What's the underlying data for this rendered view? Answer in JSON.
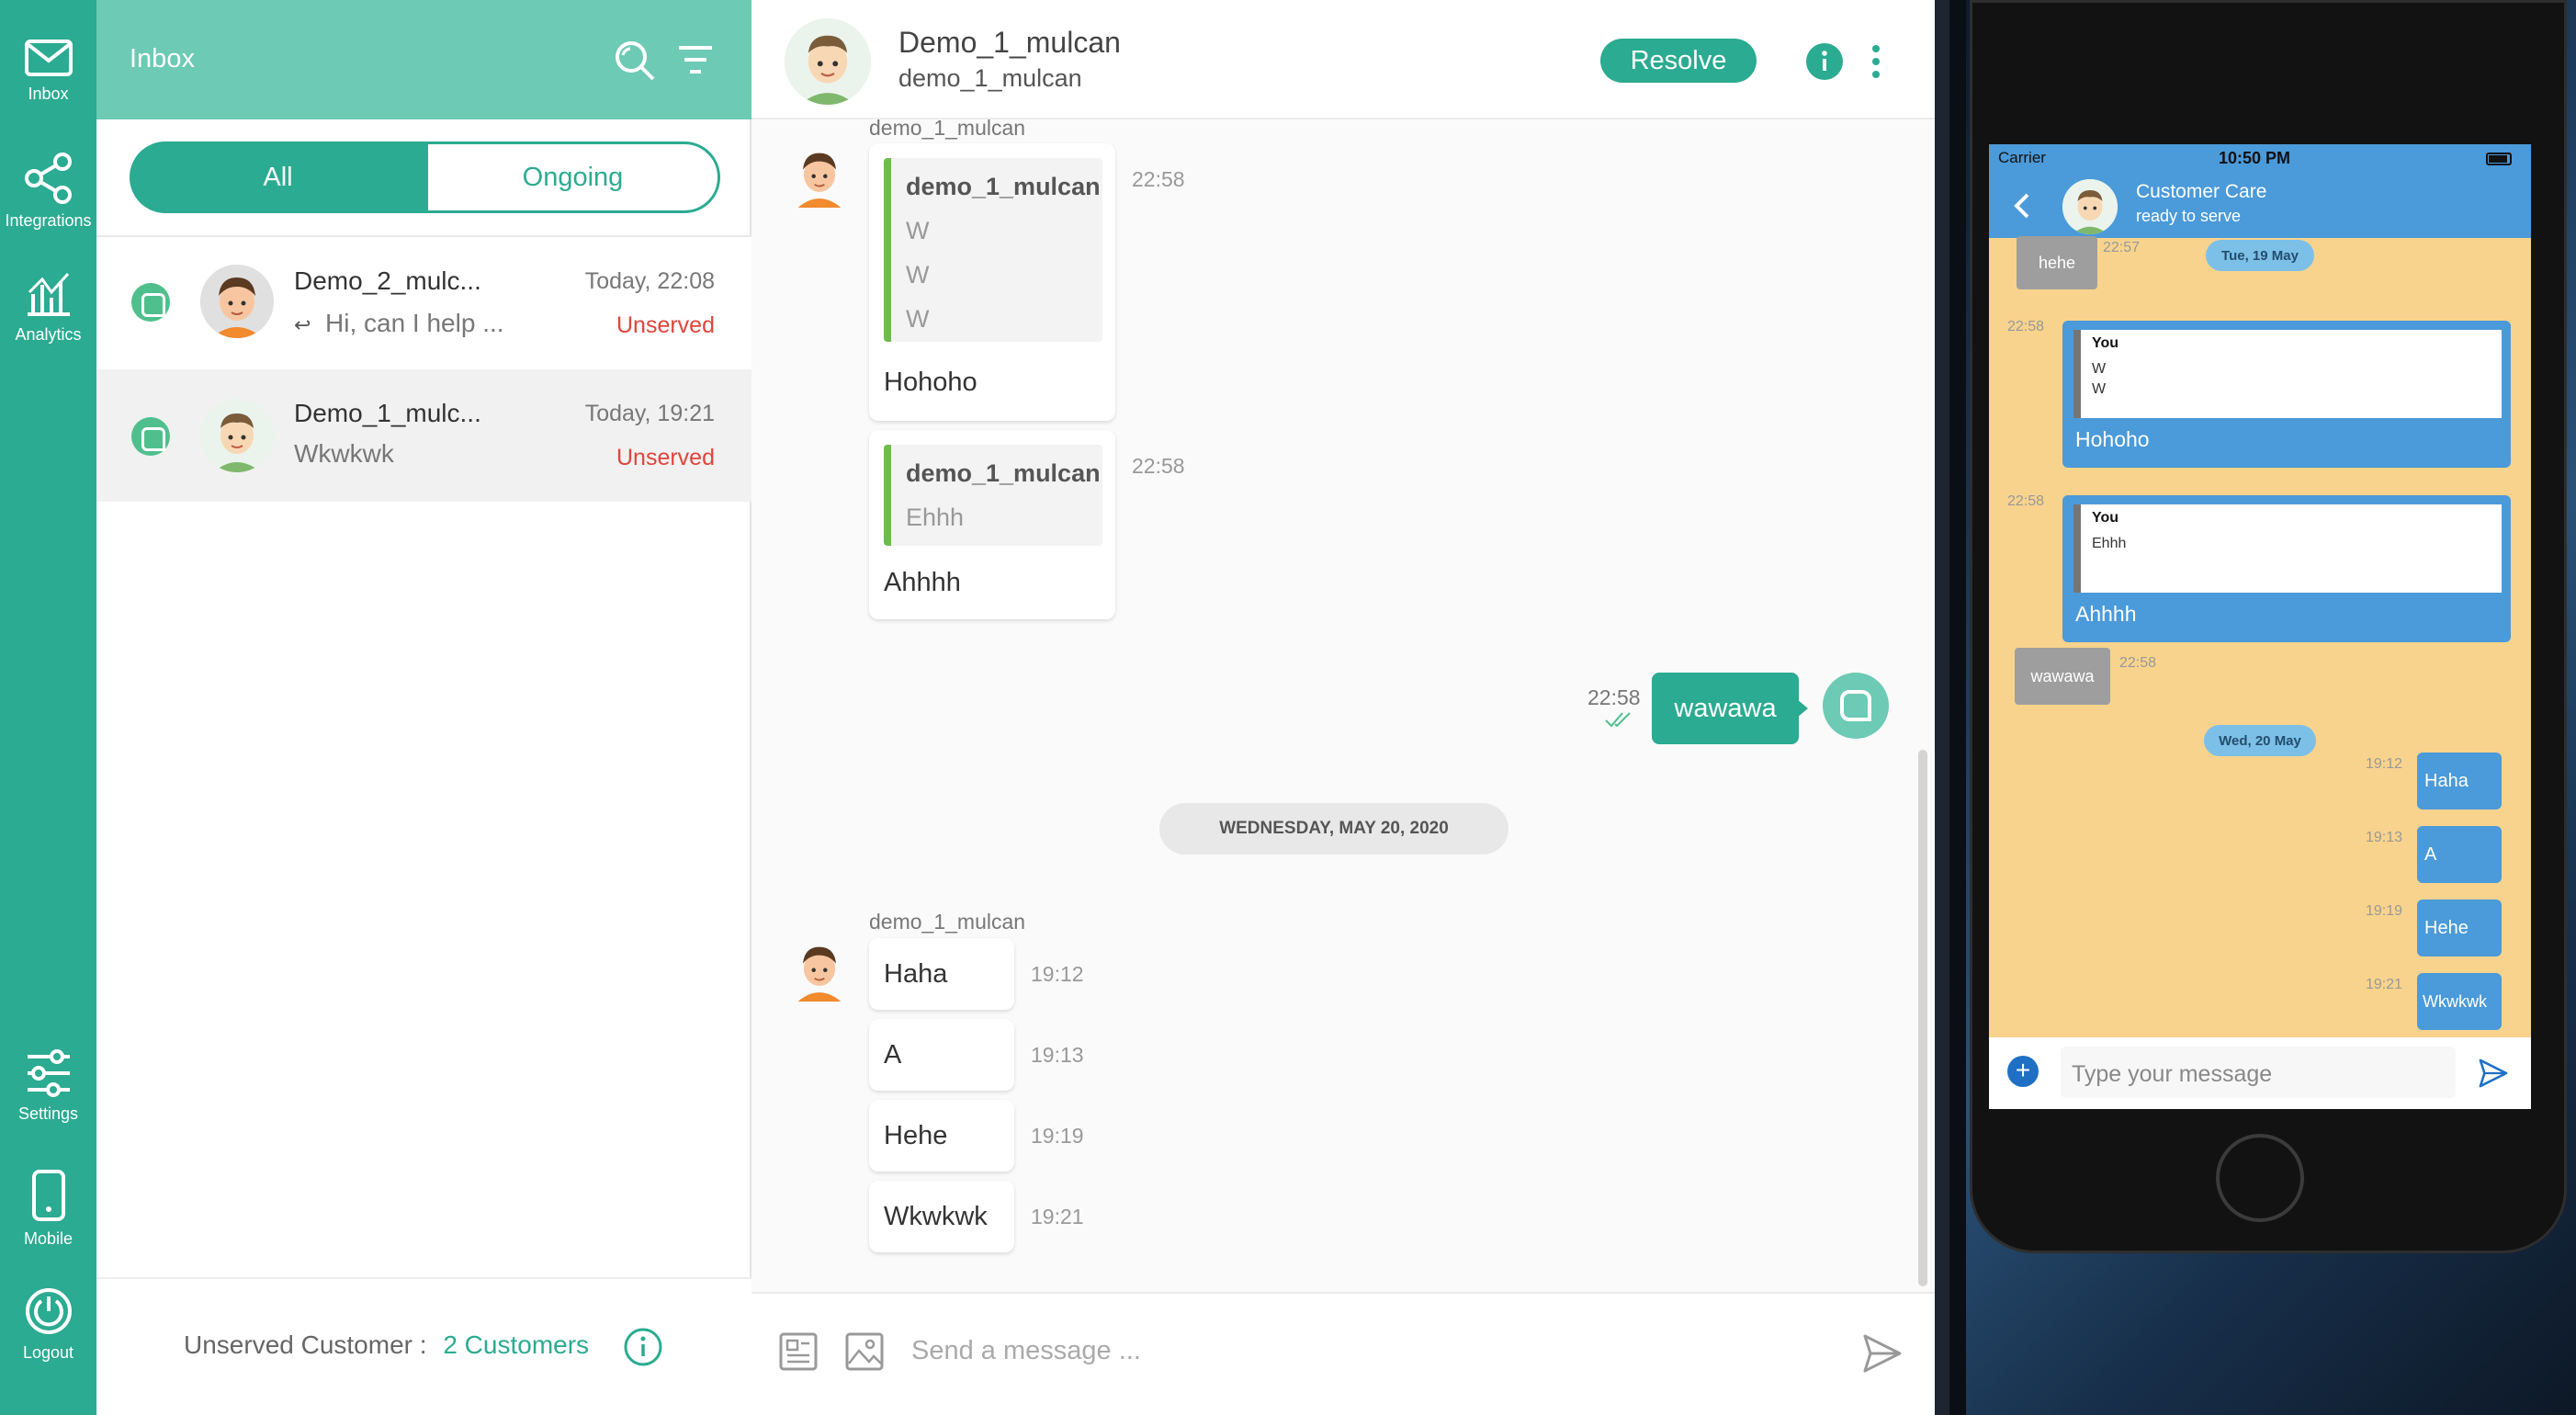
{
  "nav": {
    "items": [
      {
        "label": "Inbox",
        "icon": "mail-icon"
      },
      {
        "label": "Integrations",
        "icon": "share-icon"
      },
      {
        "label": "Analytics",
        "icon": "chart-icon"
      },
      {
        "label": "Settings",
        "icon": "sliders-icon"
      },
      {
        "label": "Mobile",
        "icon": "phone-icon"
      },
      {
        "label": "Logout",
        "icon": "power-icon"
      }
    ]
  },
  "inbox": {
    "title": "Inbox",
    "tabs": [
      "All",
      "Ongoing"
    ],
    "conversations": [
      {
        "name": "Demo_2_mulc...",
        "preview": "Hi, can I help ...",
        "time": "Today, 22:08",
        "status": "Unserved"
      },
      {
        "name": "Demo_1_mulc...",
        "preview": "Wkwkwk",
        "time": "Today, 19:21",
        "status": "Unserved"
      }
    ],
    "footer": {
      "label": "Unserved Customer :",
      "value": "2 Customers"
    }
  },
  "chat": {
    "header": {
      "name": "Demo_1_mulcan",
      "username": "demo_1_mulcan",
      "resolve_label": "Resolve"
    },
    "sender_label": "demo_1_mulcan",
    "reply1": {
      "quote_author": "demo_1_mulcan",
      "quote_lines": [
        "W",
        "W",
        "W"
      ],
      "text": "Hohoho",
      "time": "22:58"
    },
    "reply2": {
      "quote_author": "demo_1_mulcan",
      "quote_lines": [
        "Ehhh"
      ],
      "text": "Ahhhh",
      "time": "22:58"
    },
    "outgoing": {
      "text": "wawawa",
      "time": "22:58"
    },
    "date_divider": "WEDNESDAY, MAY 20, 2020",
    "messages": [
      {
        "text": "Haha",
        "time": "19:12"
      },
      {
        "text": "A",
        "time": "19:13"
      },
      {
        "text": "Hehe",
        "time": "19:19"
      },
      {
        "text": "Wkwkwk",
        "time": "19:21"
      }
    ],
    "composer_placeholder": "Send a message ..."
  },
  "phone": {
    "status": {
      "carrier": "Carrier",
      "time": "10:50 PM"
    },
    "header": {
      "title": "Customer Care",
      "subtitle": "ready to serve"
    },
    "top": {
      "text": "hehe",
      "time": "22:57",
      "date": "Tue, 19 May"
    },
    "reply1": {
      "time": "22:58",
      "quote_author": "You",
      "quote_lines": [
        "W",
        "W"
      ],
      "text": "Hohoho"
    },
    "reply2": {
      "time": "22:58",
      "quote_author": "You",
      "quote_lines": [
        "Ehhh"
      ],
      "text": "Ahhhh"
    },
    "incoming": {
      "text": "wawawa",
      "time": "22:58"
    },
    "date2": "Wed, 20 May",
    "messages": [
      {
        "text": "Haha",
        "time": "19:12"
      },
      {
        "text": "A",
        "time": "19:13"
      },
      {
        "text": "Hehe",
        "time": "19:19"
      },
      {
        "text": "Wkwkwk",
        "time": "19:21"
      }
    ],
    "input_placeholder": "Type your message"
  },
  "colors": {
    "primary": "#2bab91",
    "header_light": "#6ccab5",
    "unserved": "#e0443b",
    "quote_bar": "#6cbd4f",
    "phone_bubble": "#4b9ad9",
    "phone_bg": "#f8d38d"
  }
}
